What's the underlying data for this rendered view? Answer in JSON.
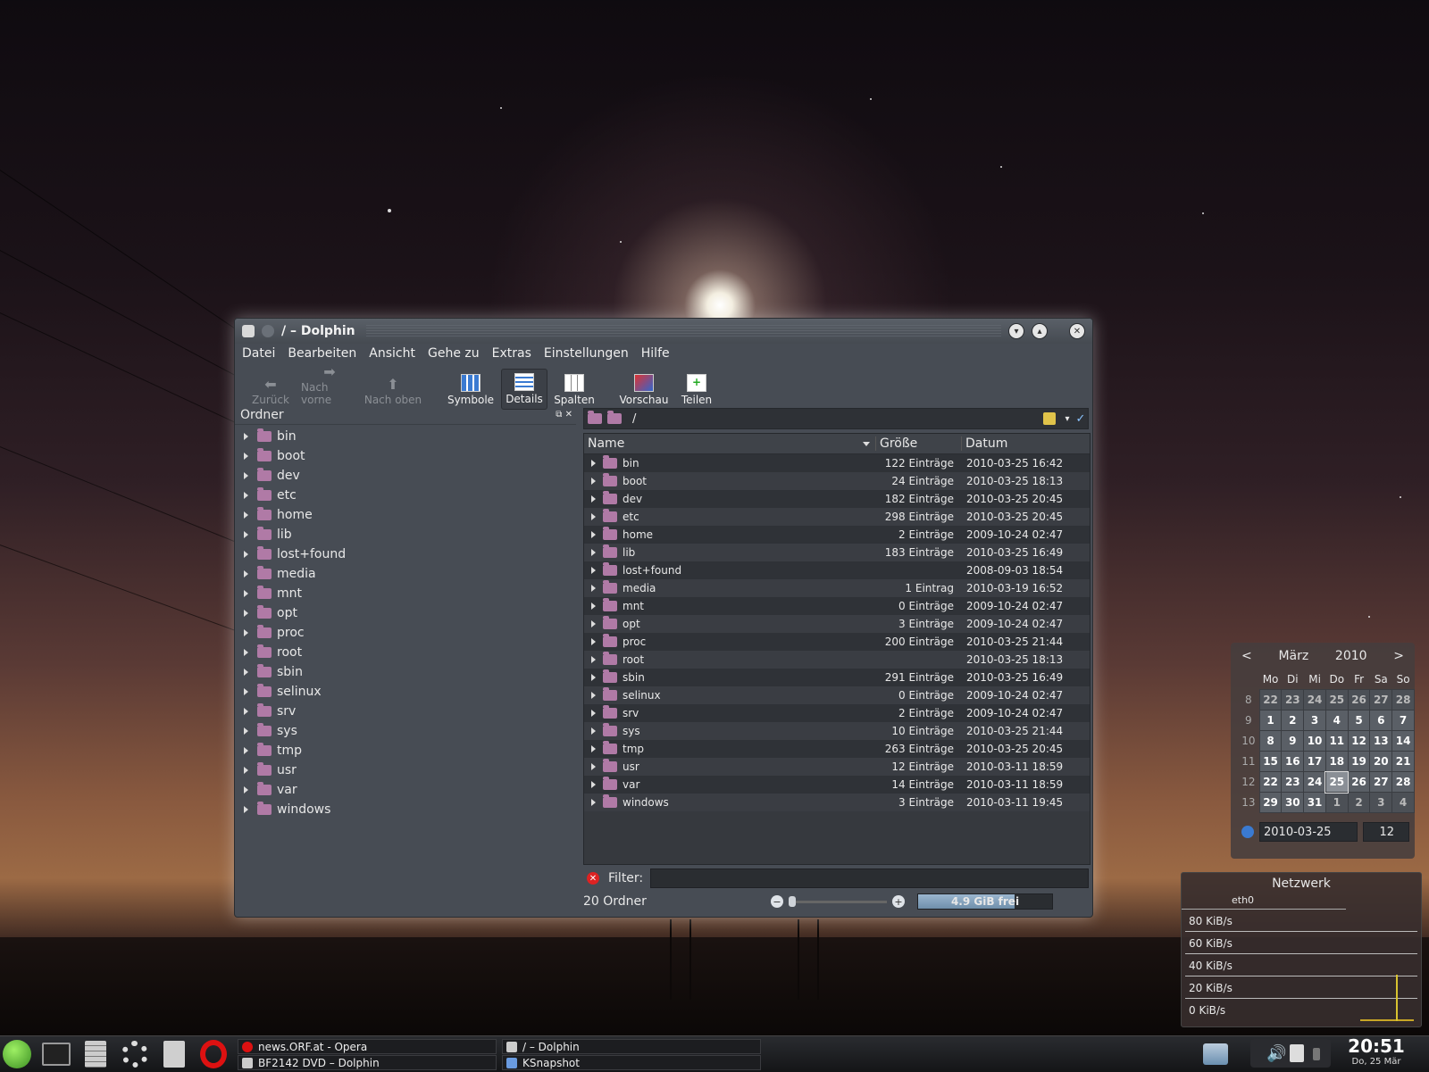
{
  "window": {
    "title": "/ – Dolphin"
  },
  "menu": [
    "Datei",
    "Bearbeiten",
    "Ansicht",
    "Gehe zu",
    "Extras",
    "Einstellungen",
    "Hilfe"
  ],
  "toolbar": {
    "back": "Zurück",
    "forward": "Nach vorne",
    "up": "Nach oben",
    "icons": "Symbole",
    "details": "Details",
    "columns": "Spalten",
    "preview": "Vorschau",
    "split": "Teilen"
  },
  "panel": {
    "title": "Ordner",
    "items": [
      "bin",
      "boot",
      "dev",
      "etc",
      "home",
      "lib",
      "lost+found",
      "media",
      "mnt",
      "opt",
      "proc",
      "root",
      "sbin",
      "selinux",
      "srv",
      "sys",
      "tmp",
      "usr",
      "var",
      "windows"
    ]
  },
  "location": {
    "path": "/"
  },
  "columns": {
    "name": "Name",
    "size": "Größe",
    "date": "Datum"
  },
  "rows": [
    {
      "name": "bin",
      "size": "122 Einträge",
      "date": "2010-03-25 16:42"
    },
    {
      "name": "boot",
      "size": "24 Einträge",
      "date": "2010-03-25 18:13"
    },
    {
      "name": "dev",
      "size": "182 Einträge",
      "date": "2010-03-25 20:45"
    },
    {
      "name": "etc",
      "size": "298 Einträge",
      "date": "2010-03-25 20:45"
    },
    {
      "name": "home",
      "size": "2 Einträge",
      "date": "2009-10-24 02:47"
    },
    {
      "name": "lib",
      "size": "183 Einträge",
      "date": "2010-03-25 16:49"
    },
    {
      "name": "lost+found",
      "size": "",
      "date": "2008-09-03 18:54"
    },
    {
      "name": "media",
      "size": "1 Eintrag",
      "date": "2010-03-19 16:52"
    },
    {
      "name": "mnt",
      "size": "0 Einträge",
      "date": "2009-10-24 02:47"
    },
    {
      "name": "opt",
      "size": "3 Einträge",
      "date": "2009-10-24 02:47"
    },
    {
      "name": "proc",
      "size": "200 Einträge",
      "date": "2010-03-25 21:44"
    },
    {
      "name": "root",
      "size": "",
      "date": "2010-03-25 18:13"
    },
    {
      "name": "sbin",
      "size": "291 Einträge",
      "date": "2010-03-25 16:49"
    },
    {
      "name": "selinux",
      "size": "0 Einträge",
      "date": "2009-10-24 02:47"
    },
    {
      "name": "srv",
      "size": "2 Einträge",
      "date": "2009-10-24 02:47"
    },
    {
      "name": "sys",
      "size": "10 Einträge",
      "date": "2010-03-25 21:44"
    },
    {
      "name": "tmp",
      "size": "263 Einträge",
      "date": "2010-03-25 20:45"
    },
    {
      "name": "usr",
      "size": "12 Einträge",
      "date": "2010-03-11 18:59"
    },
    {
      "name": "var",
      "size": "14 Einträge",
      "date": "2010-03-11 18:59"
    },
    {
      "name": "windows",
      "size": "3 Einträge",
      "date": "2010-03-11 19:45"
    }
  ],
  "filter": {
    "label": "Filter:",
    "value": ""
  },
  "status": {
    "count": "20 Ordner",
    "free": "4.9 GiB frei",
    "used_fraction": 0.72
  },
  "calendar": {
    "prev": "<",
    "next": ">",
    "month": "März",
    "year": "2010",
    "weekdays": [
      "Mo",
      "Di",
      "Mi",
      "Do",
      "Fr",
      "Sa",
      "So"
    ],
    "weeks": [
      {
        "wk": "8",
        "days": [
          "22",
          "23",
          "24",
          "25",
          "26",
          "27",
          "28"
        ],
        "other": [
          true,
          true,
          true,
          true,
          true,
          true,
          true
        ]
      },
      {
        "wk": "9",
        "days": [
          "1",
          "2",
          "3",
          "4",
          "5",
          "6",
          "7"
        ],
        "other": [
          false,
          false,
          false,
          false,
          false,
          false,
          false
        ]
      },
      {
        "wk": "10",
        "days": [
          "8",
          "9",
          "10",
          "11",
          "12",
          "13",
          "14"
        ],
        "other": [
          false,
          false,
          false,
          false,
          false,
          false,
          false
        ]
      },
      {
        "wk": "11",
        "days": [
          "15",
          "16",
          "17",
          "18",
          "19",
          "20",
          "21"
        ],
        "other": [
          false,
          false,
          false,
          false,
          false,
          false,
          false
        ]
      },
      {
        "wk": "12",
        "days": [
          "22",
          "23",
          "24",
          "25",
          "26",
          "27",
          "28"
        ],
        "other": [
          false,
          false,
          false,
          false,
          false,
          false,
          false
        ]
      },
      {
        "wk": "13",
        "days": [
          "29",
          "30",
          "31",
          "1",
          "2",
          "3",
          "4"
        ],
        "other": [
          false,
          false,
          false,
          true,
          true,
          true,
          true
        ]
      }
    ],
    "date_field": "2010-03-25",
    "week_field": "12"
  },
  "network": {
    "title": "Netzwerk",
    "interface": "eth0",
    "levels": [
      "80 KiB/s",
      "60 KiB/s",
      "40 KiB/s",
      "20 KiB/s",
      "0 KiB/s"
    ]
  },
  "taskbar": {
    "tasks": [
      {
        "label": "news.ORF.at - Opera"
      },
      {
        "label": "/ – Dolphin"
      },
      {
        "label": "BF2142 DVD – Dolphin"
      },
      {
        "label": "KSnapshot"
      }
    ],
    "clock_time": "20:51",
    "clock_date": "Do, 25 Mär"
  }
}
